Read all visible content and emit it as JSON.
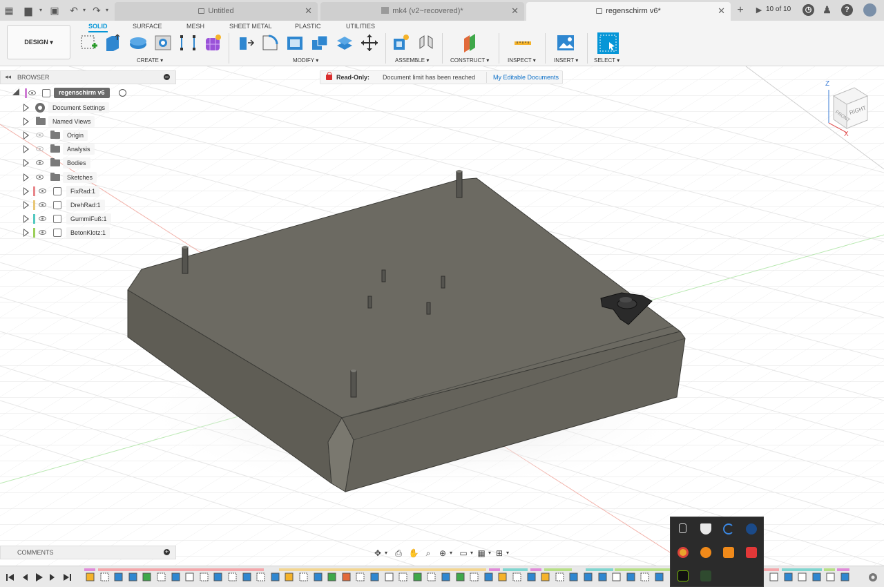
{
  "tabs": [
    {
      "label": "Untitled",
      "icon": "lock-icon",
      "active": false
    },
    {
      "label": "mk4 (v2~recovered)*",
      "icon": "cube-icon",
      "active": false
    },
    {
      "label": "regenschirm v6*",
      "icon": "lock-icon",
      "active": true
    }
  ],
  "tab_count": "10 of 10",
  "workspace": "DESIGN",
  "workspace_tabs": [
    "SOLID",
    "SURFACE",
    "MESH",
    "SHEET METAL",
    "PLASTIC",
    "UTILITIES"
  ],
  "groups": {
    "create": "CREATE",
    "modify": "MODIFY",
    "assemble": "ASSEMBLE",
    "construct": "CONSTRUCT",
    "inspect": "INSPECT",
    "insert": "INSERT",
    "select": "SELECT"
  },
  "browser": {
    "title": "BROWSER",
    "root": "regenschirm v6",
    "items": [
      {
        "label": "Document Settings",
        "icon": "gear-icon"
      },
      {
        "label": "Named Views",
        "icon": "folder-icon"
      },
      {
        "label": "Origin",
        "icon": "folder-icon"
      },
      {
        "label": "Analysis",
        "icon": "folder-icon"
      },
      {
        "label": "Bodies",
        "icon": "folder-icon"
      },
      {
        "label": "Sketches",
        "icon": "folder-icon"
      },
      {
        "label": "FixRad:1",
        "icon": "component-icon",
        "color": "#e8868a"
      },
      {
        "label": "DrehRad:1",
        "icon": "component-icon",
        "color": "#e8c777"
      },
      {
        "label": "GummiFuß:1",
        "icon": "component-icon",
        "color": "#53c8c0"
      },
      {
        "label": "BetonKlotz:1",
        "icon": "component-icon",
        "color": "#9ccf5a"
      }
    ]
  },
  "banner": {
    "title": "Read-Only:",
    "message": "Document limit has been reached",
    "link": "My Editable Documents"
  },
  "comments": {
    "title": "COMMENTS"
  },
  "viewcube": {
    "top": "TOP",
    "right": "RIGHT",
    "front": "FRONT",
    "axis_z": "Z",
    "axis_x": "X"
  },
  "colors": {
    "accent": "#0696d7",
    "model_top": "#6c6a62",
    "model_side": "#605e56",
    "readonly_red": "#d92c2c"
  }
}
